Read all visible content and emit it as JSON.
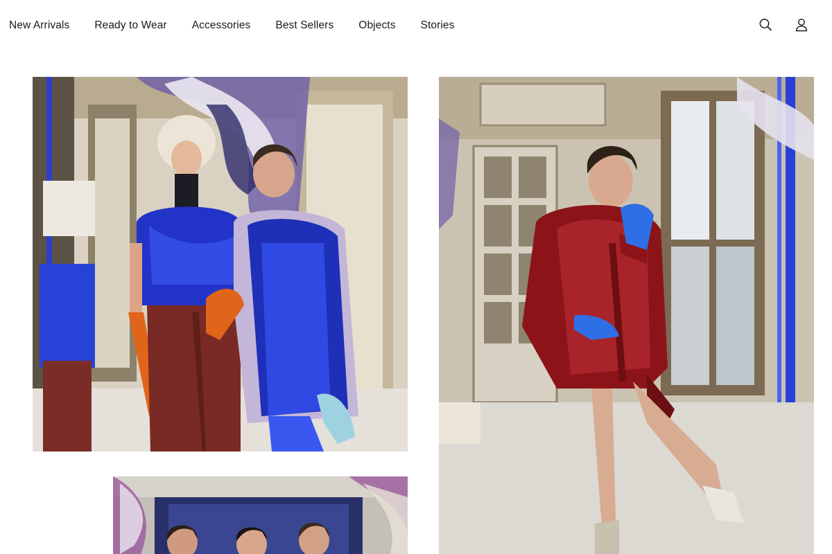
{
  "header": {
    "nav": [
      {
        "label": "New Arrivals"
      },
      {
        "label": "Ready to Wear"
      },
      {
        "label": "Accessories"
      },
      {
        "label": "Best Sellers"
      },
      {
        "label": "Objects"
      },
      {
        "label": "Stories"
      }
    ],
    "icons": [
      "search-icon",
      "account-icon"
    ]
  },
  "gallery": {
    "tiles": [
      {
        "name": "backstage-photo-duo",
        "palette": [
          "#2233c8",
          "#7a2a24",
          "#e0641a",
          "#f2ede4"
        ]
      },
      {
        "name": "backstage-photo-red-coat",
        "palette": [
          "#8c1418",
          "#2f6fe6",
          "#e9e6e0",
          "#c8c0ae"
        ]
      },
      {
        "name": "backstage-photo-group",
        "palette": [
          "#27306a",
          "#9a5a9c",
          "#e8e2d8"
        ]
      }
    ]
  }
}
